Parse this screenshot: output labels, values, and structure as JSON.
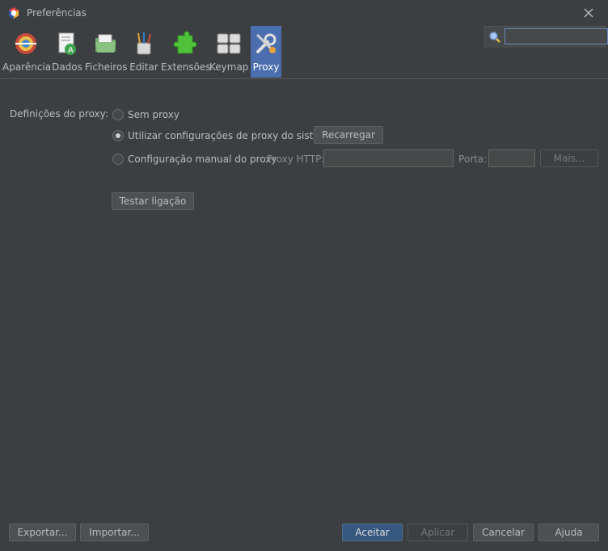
{
  "window": {
    "title": "Preferências"
  },
  "toolbar": {
    "items": [
      {
        "label": "Aparência",
        "icon": "appearance-icon"
      },
      {
        "label": "Dados",
        "icon": "data-icon"
      },
      {
        "label": "Ficheiros",
        "icon": "files-icon"
      },
      {
        "label": "Editar",
        "icon": "edit-icon"
      },
      {
        "label": "Extensões",
        "icon": "extensions-icon"
      },
      {
        "label": "Keymap",
        "icon": "keymap-icon"
      },
      {
        "label": "Proxy",
        "icon": "proxy-icon",
        "selected": true
      }
    ]
  },
  "search": {
    "value": ""
  },
  "proxy": {
    "section_label": "Definições do proxy:",
    "options": {
      "none": "Sem proxy",
      "system": "Utilizar configurações de proxy do sistema",
      "manual": "Configuração manual do proxy"
    },
    "selected_option": "system",
    "reload_button": "Recarregar",
    "http_label": "Proxy HTTP:",
    "http_value": "",
    "port_label": "Porta:",
    "port_value": "",
    "more_button": "Mais...",
    "test_button": "Testar ligação"
  },
  "footer": {
    "export_button": "Exportar...",
    "import_button": "Importar...",
    "accept_button": "Aceitar",
    "apply_button": "Aplicar",
    "cancel_button": "Cancelar",
    "help_button": "Ajuda"
  },
  "colors": {
    "accent": "#4b6eaf",
    "background": "#3c3f41",
    "primary_button": "#365880"
  }
}
